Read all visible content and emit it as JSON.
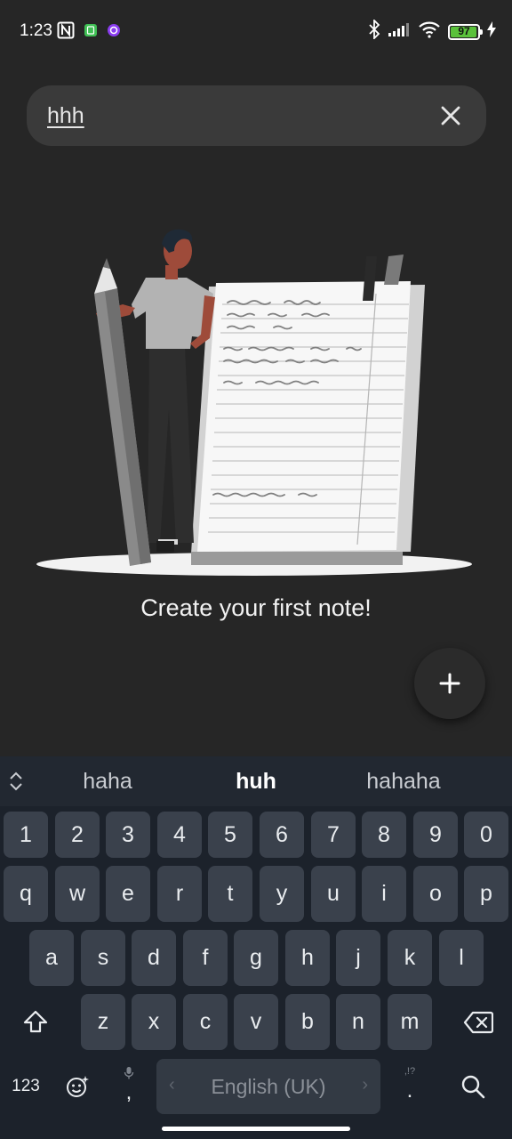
{
  "status_bar": {
    "time": "1:23",
    "battery": "97",
    "battery_level": 0.97
  },
  "search": {
    "value": "hhh"
  },
  "empty_state": {
    "message": "Create your first note!"
  },
  "fab": {
    "label": "+"
  },
  "keyboard": {
    "suggestions": [
      "haha",
      "huh",
      "hahaha"
    ],
    "number_row": [
      "1",
      "2",
      "3",
      "4",
      "5",
      "6",
      "7",
      "8",
      "9",
      "0"
    ],
    "row1": [
      "q",
      "w",
      "e",
      "r",
      "t",
      "y",
      "u",
      "i",
      "o",
      "p"
    ],
    "row2": [
      "a",
      "s",
      "d",
      "f",
      "g",
      "h",
      "j",
      "k",
      "l"
    ],
    "row3": [
      "z",
      "x",
      "c",
      "v",
      "b",
      "n",
      "m"
    ],
    "mode_key": "123",
    "comma_key": ",",
    "period_key": ".",
    "period_hint": ",!?",
    "space_label": "English (UK)",
    "space_left_arrow": "‹",
    "space_right_arrow": "›"
  },
  "colors": {
    "background": "#262626",
    "keyboard_bg": "#1c222b",
    "key_bg": "#3a414c",
    "battery_green": "#5ac13b"
  }
}
